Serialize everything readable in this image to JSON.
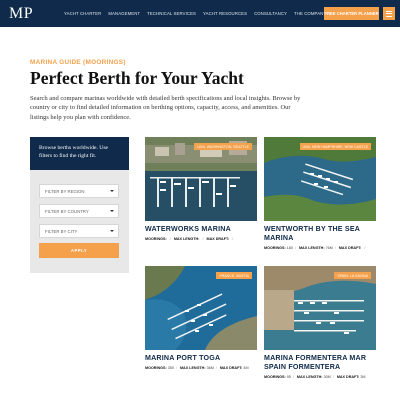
{
  "header": {
    "logo": "MP",
    "nav": [
      "YACHT CHARTER",
      "MANAGEMENT",
      "TECHNICAL SERVICES",
      "YACHT RESOURCES",
      "CONSULTANCY",
      "THE COMPANY"
    ],
    "cta": "FREE CHARTER PLANNER"
  },
  "page": {
    "kicker": "MARINA GUIDE (MOORINGS)",
    "title": "Perfect Berth for Your Yacht",
    "intro": "Search and compare marinas worldwide with detailed berth specifications and local insights. Browse by country or city to find detailed information on berthing options, capacity, access, and amenities. Our listings help you plan with confidence."
  },
  "filters": {
    "heading": "Browse berths worldwide. Use filters to find the right fit.",
    "region": "FILTER BY REGION",
    "country": "FILTER BY COUNTRY",
    "city": "FILTER BY CITY",
    "apply": "APPLY"
  },
  "meta_labels": {
    "moorings": "MOORINGS:",
    "max_length": "MAX LENGTH:",
    "max_draft": "MAX DRAFT:"
  },
  "cards": [
    {
      "name": "WATERWORKS MARINA",
      "badge": "USA, WASHINGTON, SEATTLE",
      "moorings": "",
      "max_length": "",
      "max_draft": ""
    },
    {
      "name": "WENTWORTH BY THE SEA MARINA",
      "badge": "USA, NEW HAMPSHIRE, NEW CASTLE",
      "moorings": "180",
      "max_length": "76M",
      "max_draft": ""
    },
    {
      "name": "MARINA PORT TOGA",
      "badge": "FRANCE, BASTIA",
      "moorings": "350",
      "max_length": "36M",
      "max_draft": "4M"
    },
    {
      "name": "MARINA FORMENTERA MAR SPAIN FORMENTERA",
      "badge": "SPAIN, LA SAVINA",
      "moorings": "95",
      "max_length": "30M",
      "max_draft": "3M"
    }
  ]
}
